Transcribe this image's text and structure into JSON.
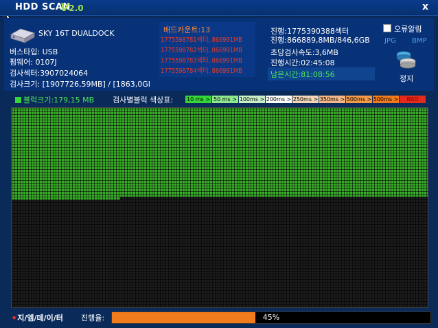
{
  "title": {
    "app_name": "HDD SCAN",
    "version_letter": "V",
    "version_num": "2.0",
    "close_label": "x"
  },
  "drive": {
    "name": "SKY 16T DUALDOCK",
    "bus_type": "버스타입: USB",
    "firmware": "펌웨어: 0107J",
    "scan_sectors": "검사섹터:3907024064",
    "scan_size": "검사크기: [1907726,59MB] / [1863,0GI"
  },
  "bad": {
    "title": "배드카운트:13",
    "entries": [
      "1775598781섹터, 866991MB",
      "1775598782섹터, 866991MB",
      "1775598783섹터, 866991MB",
      "1775598784섹터, 866991MB"
    ]
  },
  "progress_info": {
    "sector": "진행:1775390388섹터",
    "amount": "진행:866889,8MB/846,6GB",
    "speed": "초당검사속도:3,6MB",
    "elapsed": "진행시간:02:45:08",
    "remaining": "남은시간:81:08:56"
  },
  "options": {
    "error_alarm_label": "오류알림",
    "error_alarm_checked": false,
    "format_jpg": "JPG",
    "format_bmp": "BMP",
    "stop_label": "정지"
  },
  "legend": {
    "block_size": "블럭크기:179,15 MB",
    "label": "검사별블럭 색상표:",
    "cells": [
      {
        "label": "10 ms >",
        "color": "#36d63a"
      },
      {
        "label": "50 ms >",
        "color": "#8ee88e"
      },
      {
        "label": "100ms >",
        "color": "#c8f0c8"
      },
      {
        "label": "200ms >",
        "color": "#ffffff"
      },
      {
        "label": "250ms >",
        "color": "#f2d8b8"
      },
      {
        "label": "350ms >",
        "color": "#f4b888"
      },
      {
        "label": "500ms >",
        "color": "#f59a4a"
      },
      {
        "label": "500ms >",
        "color": "#f27a1a"
      },
      {
        "label": "BAD",
        "color": "#e42a1a"
      }
    ]
  },
  "footer": {
    "brand": "지/엠/데/이/터",
    "progress_label": "진행율:",
    "progress_percent": 45,
    "progress_text": "45%"
  },
  "colors": {
    "good_block": "#3aaa2a",
    "unscanned_block": "#1c1c1c",
    "progress_fill": "#f27b1c"
  }
}
